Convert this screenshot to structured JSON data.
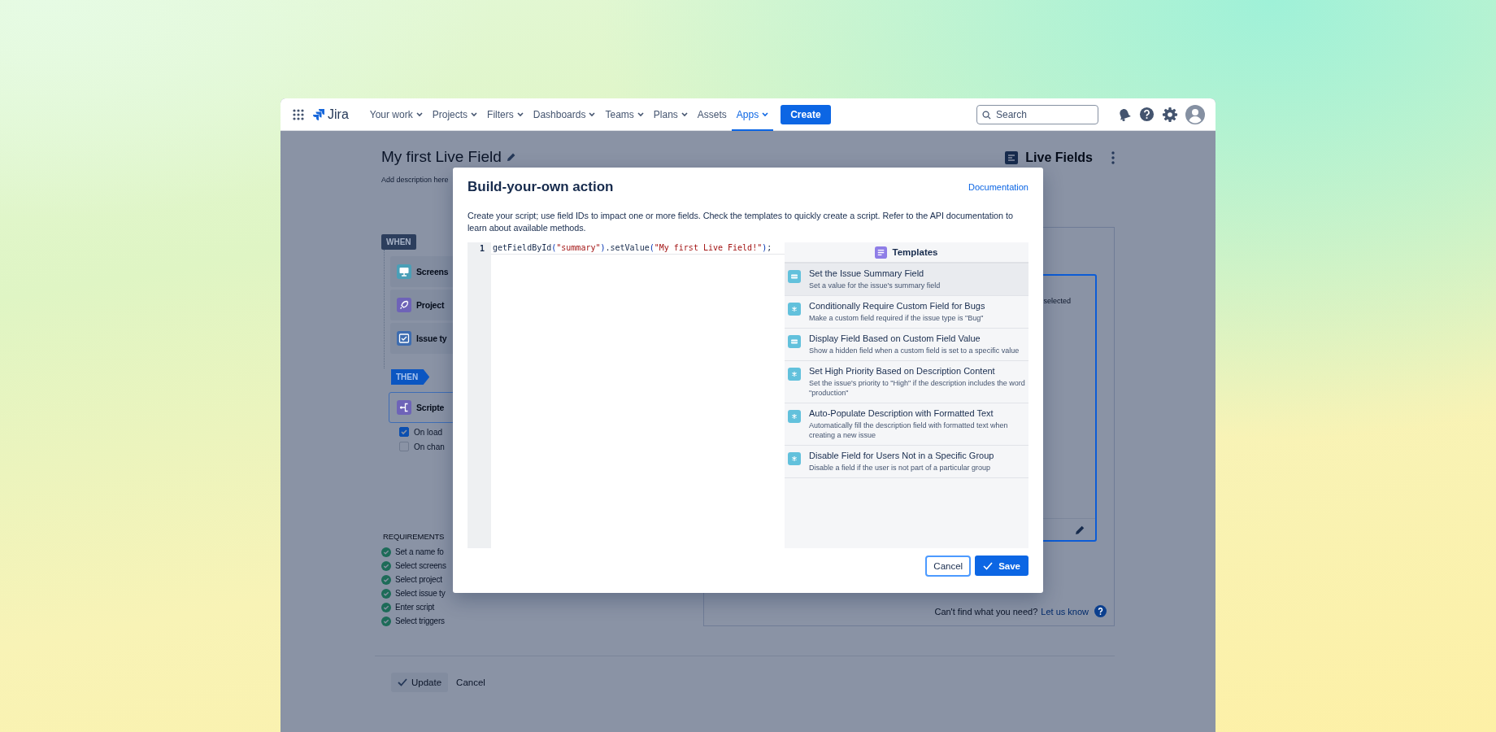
{
  "nav": {
    "app_name": "Jira",
    "items": [
      {
        "label": "Your work",
        "dropdown": true,
        "selected": false
      },
      {
        "label": "Projects",
        "dropdown": true,
        "selected": false
      },
      {
        "label": "Filters",
        "dropdown": true,
        "selected": false
      },
      {
        "label": "Dashboards",
        "dropdown": true,
        "selected": false
      },
      {
        "label": "Teams",
        "dropdown": true,
        "selected": false
      },
      {
        "label": "Plans",
        "dropdown": true,
        "selected": false
      },
      {
        "label": "Assets",
        "dropdown": false,
        "selected": false
      },
      {
        "label": "Apps",
        "dropdown": true,
        "selected": true
      }
    ],
    "create_button": "Create",
    "search": {
      "placeholder": "Search"
    }
  },
  "page": {
    "title": "My first Live Field",
    "description_placeholder": "Add description here",
    "when_tag": "WHEN",
    "triggers": [
      {
        "label": "Screens",
        "kind": "screen"
      },
      {
        "label": "Project",
        "kind": "project"
      },
      {
        "label": "Issue ty",
        "kind": "issue-type"
      }
    ],
    "then_tag": "THEN",
    "action": {
      "label": "Scripte"
    },
    "events": [
      {
        "label": "On load",
        "checked": true
      },
      {
        "label": "On chan",
        "checked": false
      }
    ],
    "requirements_title": "REQUIREMENTS",
    "requirements": [
      {
        "label": "Set a name fo",
        "done": true
      },
      {
        "label": "Select screens",
        "done": true
      },
      {
        "label": "Select project",
        "done": true
      },
      {
        "label": "Select issue ty",
        "done": true
      },
      {
        "label": "Enter script",
        "done": true
      },
      {
        "label": "Select triggers",
        "done": true
      }
    ],
    "update_button": "Update",
    "cancel_button": "Cancel",
    "app_label": "Live Fields",
    "side_panel": {
      "note": "selected",
      "help_text": "Can't find what you need?",
      "help_link": "Let us know"
    }
  },
  "modal": {
    "title": "Build-your-own action",
    "documentation_link": "Documentation",
    "description": "Create your script; use field IDs to impact one or more fields. Check the templates to quickly create a script. Refer to the API documentation to learn about available methods.",
    "code_lines": [
      {
        "number": "1",
        "tokens": [
          {
            "text": "getFieldById",
            "kind": "plain"
          },
          {
            "text": "(",
            "kind": "punct"
          },
          {
            "text": "\"summary\"",
            "kind": "string"
          },
          {
            "text": ")",
            "kind": "punct"
          },
          {
            "text": ".setValue",
            "kind": "plain"
          },
          {
            "text": "(",
            "kind": "punct"
          },
          {
            "text": "\"My first Live Field!\"",
            "kind": "string"
          },
          {
            "text": ")",
            "kind": "punct"
          },
          {
            "text": ";",
            "kind": "plain"
          }
        ]
      }
    ],
    "templates_title": "Templates",
    "templates": [
      {
        "title": "Set the Issue Summary Field",
        "description": "Set a value for the issue's summary field",
        "kind": "lines",
        "selected": true
      },
      {
        "title": "Conditionally Require Custom Field for Bugs",
        "description": "Make a custom field required if the issue type is \"Bug\"",
        "kind": "asterisk",
        "selected": false
      },
      {
        "title": "Display Field Based on Custom Field Value",
        "description": "Show a hidden field when a custom field is set to a specific value",
        "kind": "lines",
        "selected": false
      },
      {
        "title": "Set High Priority Based on Description Content",
        "description": "Set the issue's priority to \"High\" if the description includes the word \"production\"",
        "kind": "asterisk",
        "selected": false
      },
      {
        "title": "Auto-Populate Description with Formatted Text",
        "description": "Automatically fill the description field with formatted text when creating a new issue",
        "kind": "asterisk",
        "selected": false
      },
      {
        "title": "Disable Field for Users Not in a Specific Group",
        "description": "Disable a field if the user is not part of a particular group",
        "kind": "asterisk",
        "selected": false
      }
    ],
    "cancel_button": "Cancel",
    "save_button": "Save"
  }
}
